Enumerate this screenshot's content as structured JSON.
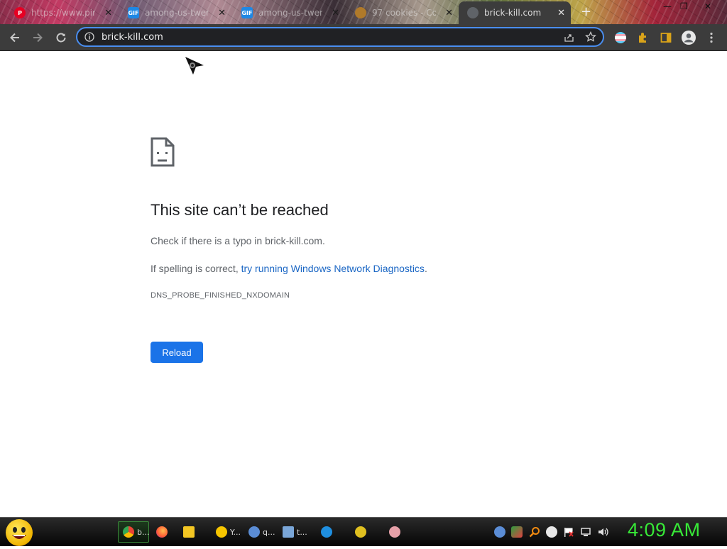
{
  "tabs": [
    {
      "title": "https://www.pin",
      "favicon": "pinterest-icon",
      "color": "#e60023"
    },
    {
      "title": "among-us-twerk",
      "favicon": "gif-icon",
      "color": "#1e88e5"
    },
    {
      "title": "among-us-twerk",
      "favicon": "gif-icon",
      "color": "#1e88e5"
    },
    {
      "title": "97 cookies - Co",
      "favicon": "cookie-icon",
      "color": "#b07a2a"
    },
    {
      "title": "brick-kill.com",
      "favicon": "globe-icon",
      "color": "#9aa0a6",
      "active": true
    }
  ],
  "omnibox": {
    "url": "brick-kill.com"
  },
  "error": {
    "heading": "This site can’t be reached",
    "line1": "Check if there is a typo in brick-kill.com.",
    "line2_prefix": "If spelling is correct, ",
    "line2_link": "try running Windows Network Diagnostics",
    "line2_suffix": ".",
    "code": "DNS_PROBE_FINISHED_NXDOMAIN",
    "reload_label": "Reload"
  },
  "taskbar": {
    "apps": [
      {
        "label": "b...",
        "icon": "chrome-icon",
        "active": true
      },
      {
        "label": "",
        "icon": "firefox-icon"
      },
      {
        "label": "",
        "icon": "folder-icon"
      },
      {
        "label": "Y...",
        "icon": "emoji-icon"
      },
      {
        "label": "q...",
        "icon": "qb-icon"
      },
      {
        "label": "t...",
        "icon": "window-icon"
      },
      {
        "label": "",
        "icon": "ie-icon"
      },
      {
        "label": "",
        "icon": "x-tool-icon"
      },
      {
        "label": "",
        "icon": "brain-icon"
      }
    ],
    "clock": "4:09 AM"
  },
  "colors": {
    "accent": "#1a73e8",
    "link": "#1a66c4",
    "clock": "#37e837"
  }
}
